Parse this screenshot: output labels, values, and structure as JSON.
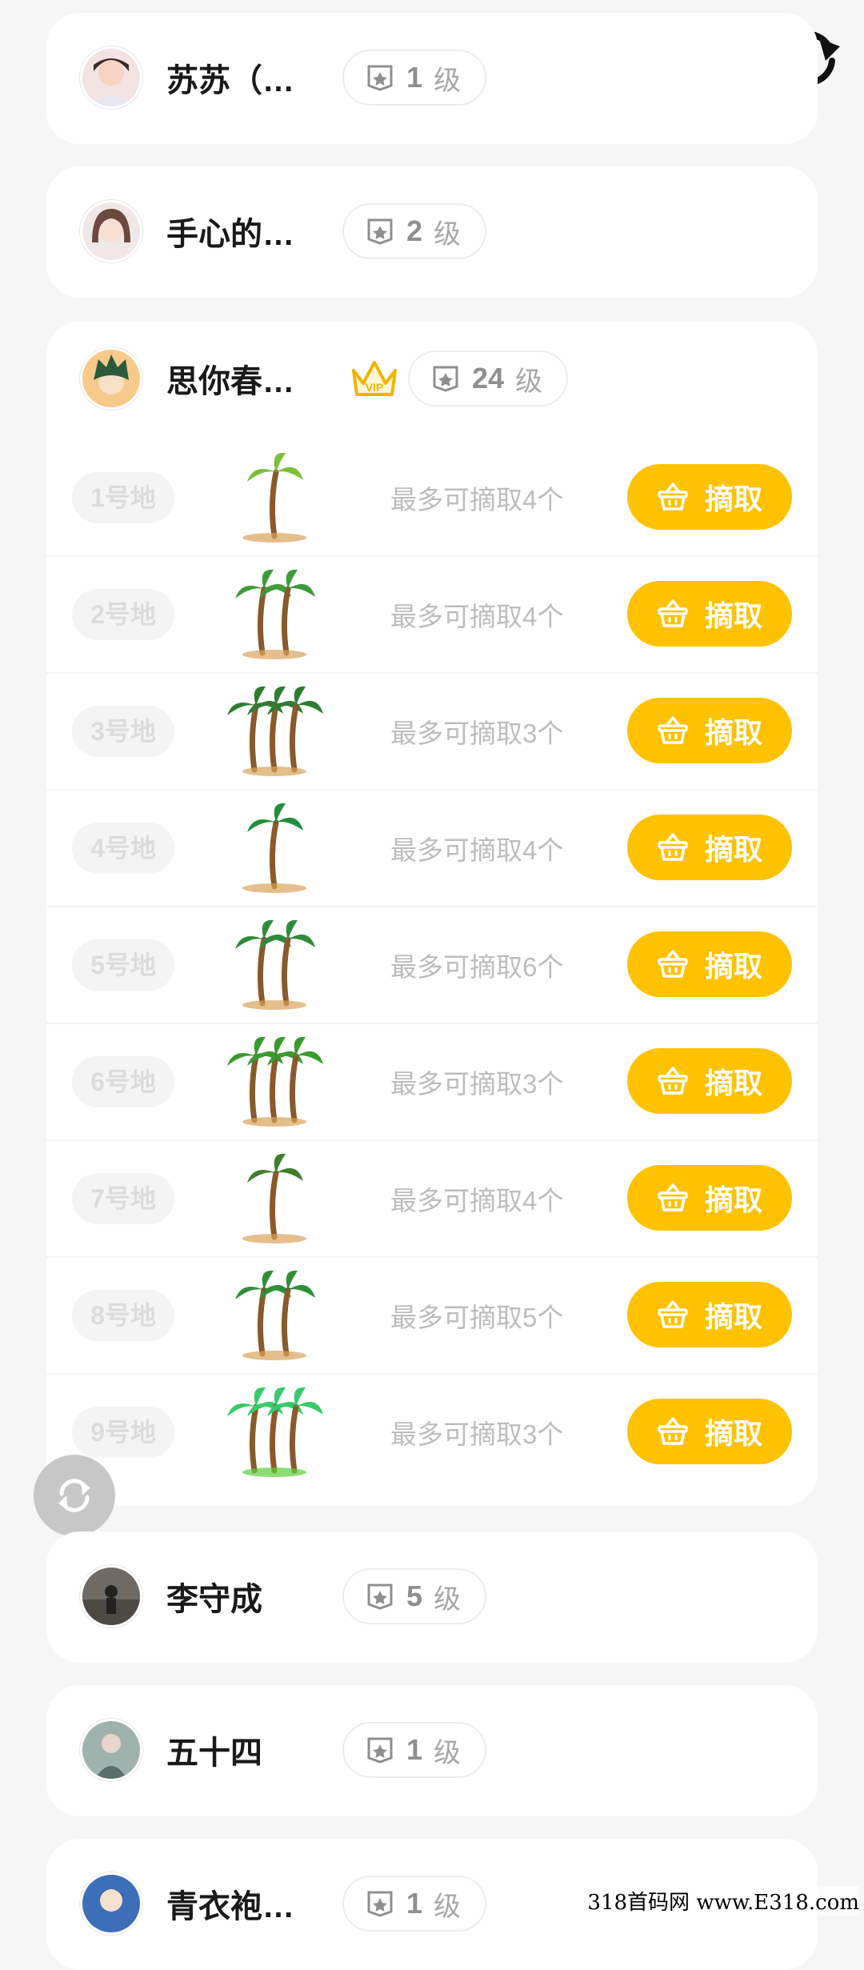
{
  "users_top": [
    {
      "name": "苏苏（…",
      "level": "1",
      "level_unit": "级"
    },
    {
      "name": "手心的…",
      "level": "2",
      "level_unit": "级"
    }
  ],
  "expanded_user": {
    "name": "思你春…",
    "vip_label": "VIP",
    "level": "24",
    "level_unit": "级",
    "plots": [
      {
        "label": "1号地",
        "max_text": "最多可摘取4个",
        "button": "摘取",
        "tree": "single-palm-icon"
      },
      {
        "label": "2号地",
        "max_text": "最多可摘取4个",
        "button": "摘取",
        "tree": "twin-palm-icon"
      },
      {
        "label": "3号地",
        "max_text": "最多可摘取3个",
        "button": "摘取",
        "tree": "small-palm-pair-icon"
      },
      {
        "label": "4号地",
        "max_text": "最多可摘取4个",
        "button": "摘取",
        "tree": "island-palm-icon"
      },
      {
        "label": "5号地",
        "max_text": "最多可摘取6个",
        "button": "摘取",
        "tree": "coconut-palm-icon"
      },
      {
        "label": "6号地",
        "max_text": "最多可摘取3个",
        "button": "摘取",
        "tree": "palm-umbrella-icon"
      },
      {
        "label": "7号地",
        "max_text": "最多可摘取4个",
        "button": "摘取",
        "tree": "palm-monkey-icon"
      },
      {
        "label": "8号地",
        "max_text": "最多可摘取5个",
        "button": "摘取",
        "tree": "palm-cluster-icon"
      },
      {
        "label": "9号地",
        "max_text": "最多可摘取3个",
        "button": "摘取",
        "tree": "palm-grove-icon"
      }
    ]
  },
  "users_bottom": [
    {
      "name": "李守成",
      "level": "5",
      "level_unit": "级"
    },
    {
      "name": "五十四",
      "level": "1",
      "level_unit": "级"
    },
    {
      "name": "青衣袍…",
      "level": "1",
      "level_unit": "级"
    }
  ],
  "watermark": "318首码网 www.E318.com",
  "colors": {
    "accent": "#fec200",
    "background": "#f6f6f6"
  }
}
